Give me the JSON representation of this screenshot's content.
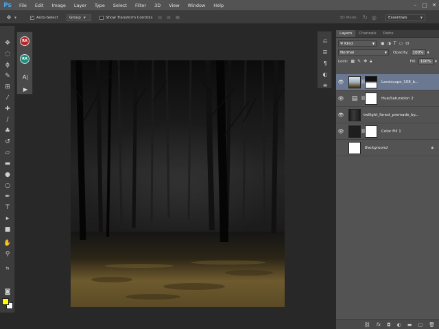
{
  "app": {
    "logo": "Ps",
    "menus": [
      "File",
      "Edit",
      "Image",
      "Layer",
      "Type",
      "Select",
      "Filter",
      "3D",
      "View",
      "Window",
      "Help"
    ],
    "window_controls": {
      "minimize": "–",
      "maximize": "□",
      "close": "✕"
    }
  },
  "options_bar": {
    "auto_select_label": "Auto-Select",
    "auto_select_checked": true,
    "target_value": "Group",
    "show_transform_label": "Show Transform Controls",
    "show_transform_checked": false,
    "mode_label": "3D Mode:",
    "workspace_value": "Essentials"
  },
  "toolbar": {
    "tools": [
      "move-tool",
      "marquee-tool",
      "lasso-tool",
      "quick-select-tool",
      "crop-tool",
      "eyedropper-tool",
      "healing-brush-tool",
      "brush-tool",
      "clone-stamp-tool",
      "history-brush-tool",
      "eraser-tool",
      "gradient-tool",
      "blur-tool",
      "dodge-tool",
      "pen-tool",
      "type-tool",
      "path-select-tool",
      "rectangle-tool",
      "hand-tool",
      "zoom-tool"
    ],
    "foreground_color": "#ffff00",
    "background_color": "#ffffff"
  },
  "mini_panel": {
    "item1": "RA",
    "item2": "RA",
    "item3": "A|"
  },
  "layers_panel": {
    "tabs": [
      "Layers",
      "Channels",
      "Paths"
    ],
    "kind_label": "Kind",
    "blend_mode": "Normal",
    "opacity_label": "Opacity:",
    "opacity_value": "100%",
    "lock_label": "Lock:",
    "fill_label": "Fill:",
    "fill_value": "100%",
    "layers": [
      {
        "name": "Landscape_108_b...",
        "visible": true,
        "selected": true,
        "italic": false
      },
      {
        "name": "Hue/Saturation 2",
        "visible": true,
        "selected": false,
        "italic": false
      },
      {
        "name": "twilight_forest_premade_by...",
        "visible": true,
        "selected": false,
        "italic": false
      },
      {
        "name": "Color Fill 1",
        "visible": true,
        "selected": false,
        "italic": false
      },
      {
        "name": "Background",
        "visible": false,
        "selected": false,
        "italic": true
      }
    ],
    "footer_icons": [
      "link-icon",
      "fx-icon",
      "mask-icon",
      "adjustment-icon",
      "folder-icon",
      "new-layer-icon",
      "trash-icon"
    ]
  },
  "colors": {
    "menubar": "#535353",
    "panel": "#535353",
    "selected_layer": "#6a7891",
    "workspace": "#282828"
  }
}
